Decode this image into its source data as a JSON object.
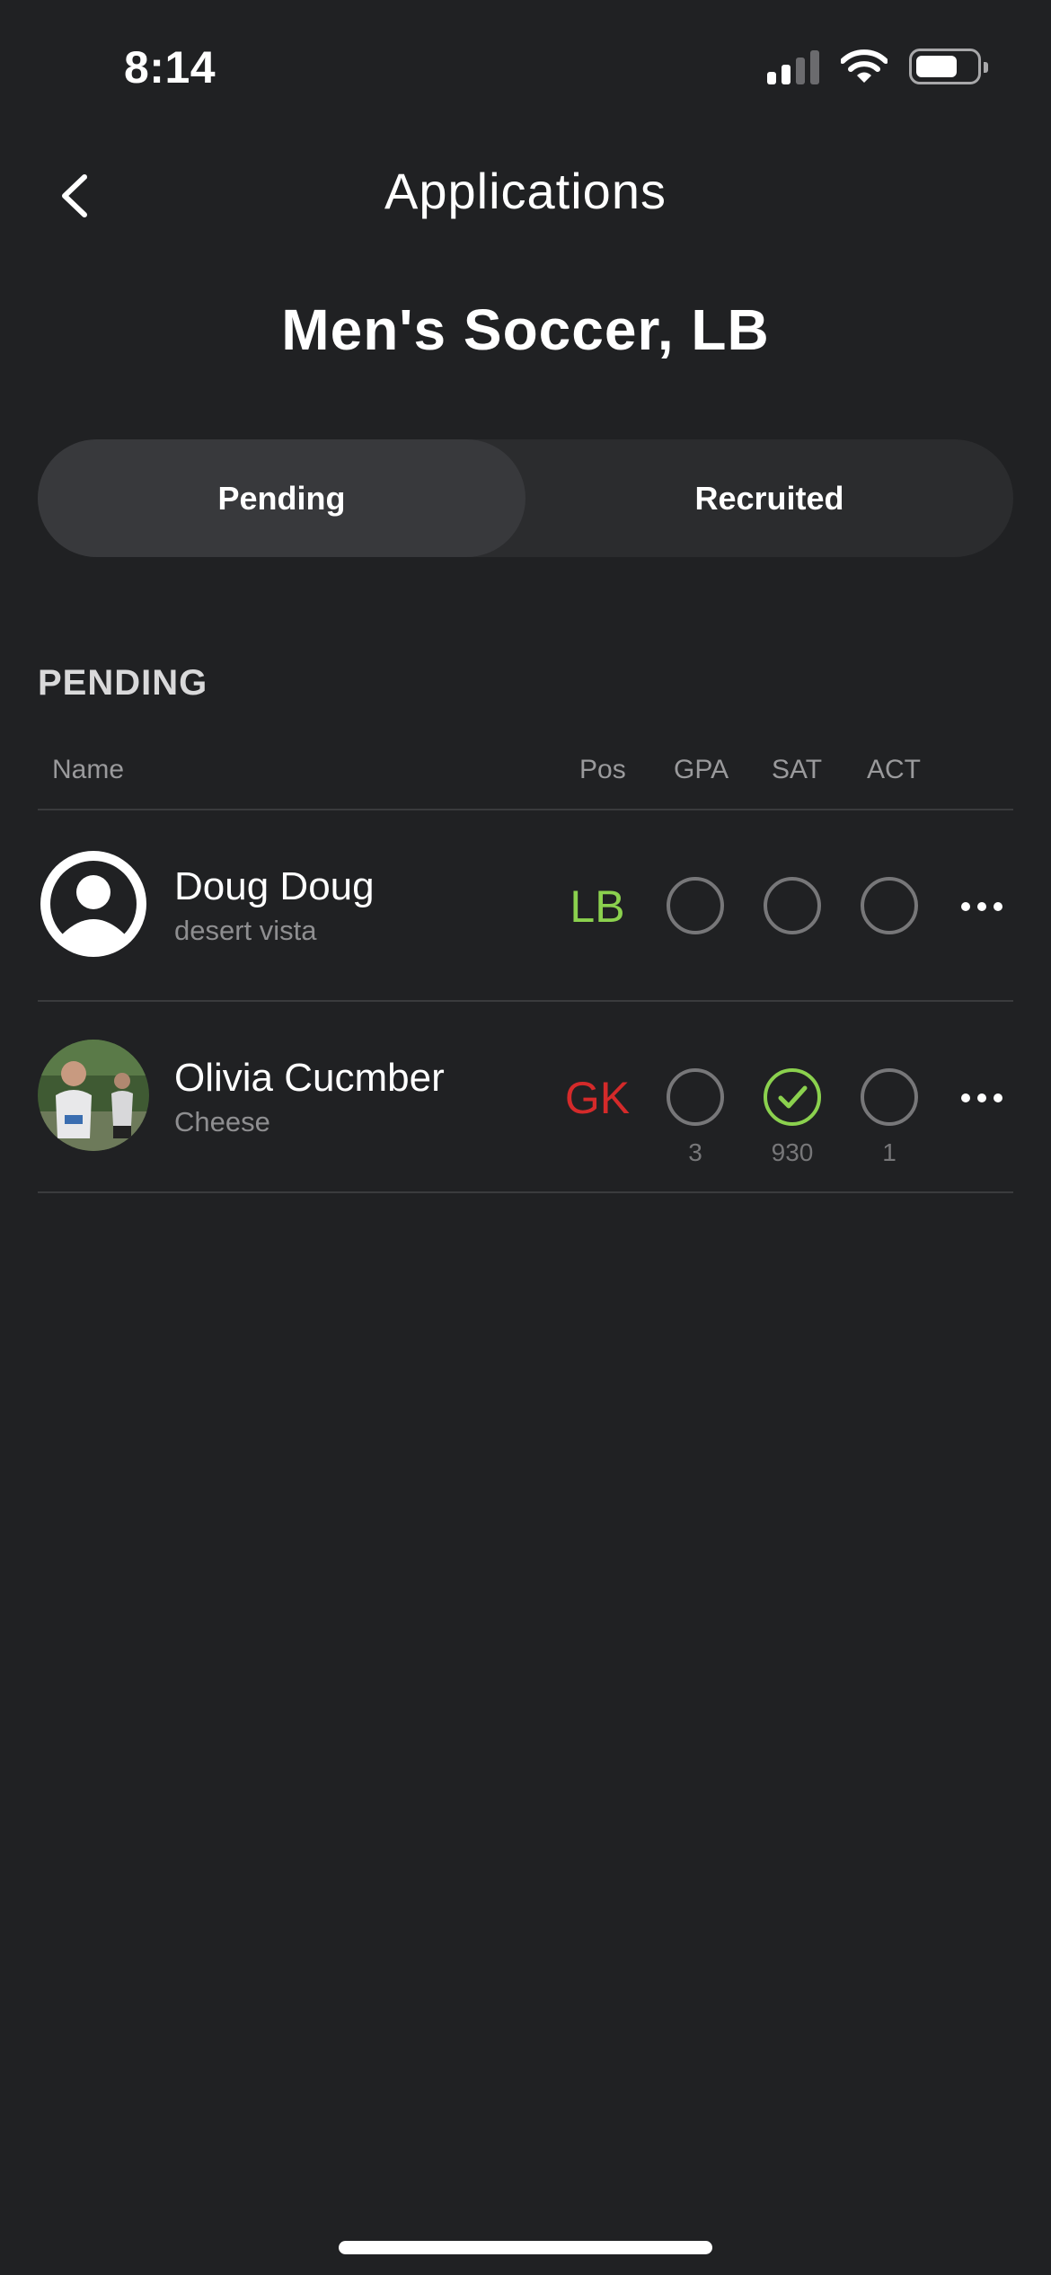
{
  "status_bar": {
    "time": "8:14"
  },
  "nav": {
    "title": "Applications"
  },
  "page": {
    "title": "Men's Soccer, LB"
  },
  "tabs": [
    {
      "label": "Pending",
      "active": true
    },
    {
      "label": "Recruited",
      "active": false
    }
  ],
  "section": {
    "label": "PENDING",
    "columns": {
      "name": "Name",
      "pos": "Pos",
      "gpa": "GPA",
      "sat": "SAT",
      "act": "ACT"
    }
  },
  "applicants": [
    {
      "name": "Doug Doug",
      "school": "desert vista",
      "position": "LB",
      "position_color": "#8bd14e",
      "avatar_icon": "user-circle-icon",
      "gpa": {
        "checked": false,
        "value": ""
      },
      "sat": {
        "checked": false,
        "value": ""
      },
      "act": {
        "checked": false,
        "value": ""
      }
    },
    {
      "name": "Olivia Cucmber",
      "school": "Cheese",
      "position": "GK",
      "position_color": "#d42a2a",
      "avatar_icon": "photo-avatar",
      "gpa": {
        "checked": false,
        "value": "3"
      },
      "sat": {
        "checked": true,
        "value": "930"
      },
      "act": {
        "checked": false,
        "value": "1"
      }
    }
  ],
  "colors": {
    "background": "#202123",
    "accent_green": "#8bd14e",
    "accent_red": "#d42a2a"
  }
}
